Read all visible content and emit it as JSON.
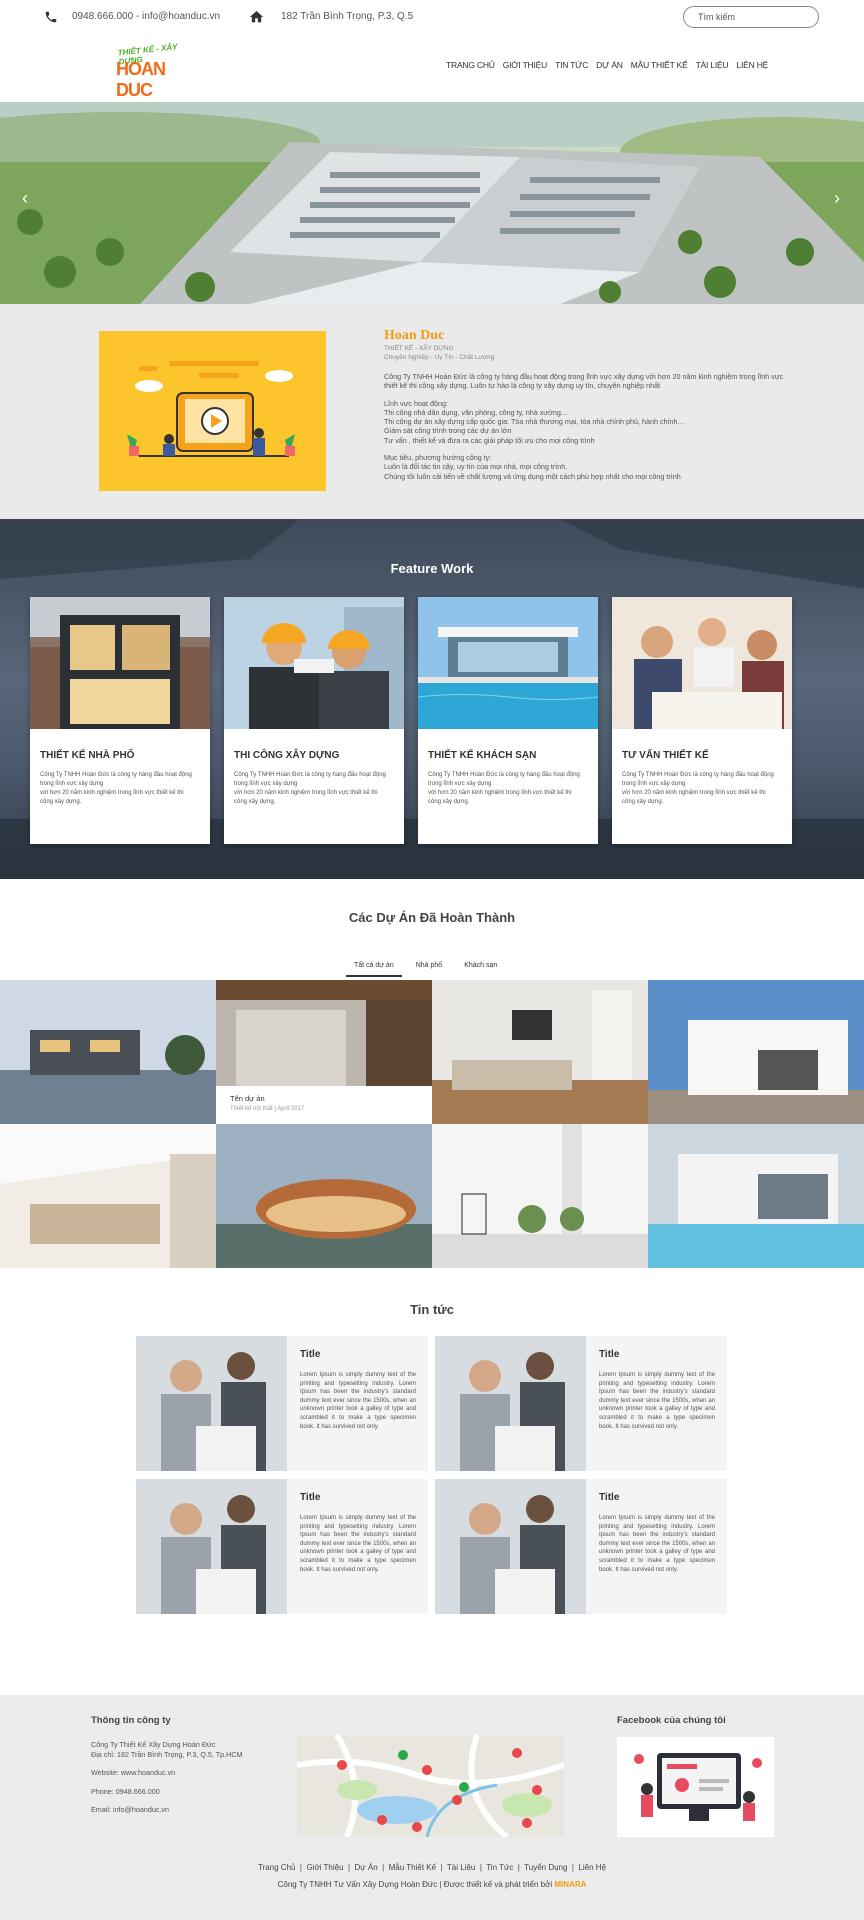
{
  "topbar": {
    "contact": "0948.666.000 - info@hoanduc.vn",
    "address": "182 Trần Bình Trọng, P.3, Q.5",
    "search_placeholder": "Tìm kiếm"
  },
  "logo": {
    "tagline": "THIẾT KẾ - XÂY DỰNG",
    "name": "HOAN DUC"
  },
  "nav": [
    "TRANG CHỦ",
    "GIỚI THIỆU",
    "TIN TỨC",
    "DỰ ÁN",
    "MẪU THIẾT KẾ",
    "TÀI LIỆU",
    "LIÊN HỆ"
  ],
  "hero": {
    "prev": "‹",
    "next": "›"
  },
  "about": {
    "title": "Hoan Duc",
    "sub1": "THIẾT KẾ - XÂY DỰNG",
    "sub2": "Chuyên Nghiệp - Uy Tín - Chất Lượng",
    "intro": "Công Ty TNHH Hoàn Đức là công ty hàng đầu hoạt động trong lĩnh vực xây dựng  với hơn 20 năm kinh nghiệm trong lĩnh vực thiết kế thi công xây dựng. Luôn tự hào là công ty xây dựng uy tín, chuyên nghiệp nhất",
    "fields_heading": "Lĩnh vực hoạt động:",
    "fields": [
      "Thi công nhà dân dụng, văn phòng, công ty, nhà xưởng…",
      "Thi công dự án xây dựng cấp quốc gia: Tòa nhà thương mại, tòa nhà chính phủ, hành chính…",
      "Giám sát công trình trong các dự án lớn",
      "Tư vấn , thiết kế và đưa ra các giải pháp tối ưu cho mọi công trình"
    ],
    "goals_heading": "Mục tiêu, phương hướng công ty:",
    "goals": [
      "Luôn là đối tác tin cậy, uy tín của mọi nhà, mọi công trình.",
      "Chúng tôi luôn cải tiến về chất lượng và ứng dụng một cách phù hợp nhất cho mọi công trình"
    ]
  },
  "feature": {
    "title": "Feature Work",
    "cards": [
      {
        "title": "THIẾT KẾ NHÀ PHỐ",
        "l1": "Công Ty TNHH Hoàn Đức là công ty hàng đầu hoạt động",
        "l2": "trong lĩnh vực xây dựng",
        "l3": "với hơn 20 năm kinh nghiệm trong lĩnh vực thiết kế thi",
        "l4": "công xây dựng."
      },
      {
        "title": "THI CÔNG XÂY DỰNG",
        "l1": "Công Ty TNHH Hoàn Đức là công ty hàng đầu hoạt động",
        "l2": "trong lĩnh vực xây dựng",
        "l3": "với hơn 20 năm kinh nghiệm trong lĩnh vực thiết kế thi",
        "l4": "công xây dựng."
      },
      {
        "title": "THIẾT KẾ KHÁCH SẠN",
        "l1": "Công Ty TNHH Hoàn Đức là công ty hàng đầu hoạt động",
        "l2": "trong lĩnh vực xây dựng",
        "l3": "với hơn 20 năm kinh nghiệm trong lĩnh vực thiết kế thi",
        "l4": "công xây dựng."
      },
      {
        "title": "TƯ VẤN THIẾT KẾ",
        "l1": "Công Ty TNHH Hoàn Đức là công ty hàng đầu hoạt động",
        "l2": "trong lĩnh vực xây dựng",
        "l3": "với hơn 20 năm kinh nghiệm trong lĩnh vực thiết kế thi",
        "l4": "công xây dựng."
      }
    ]
  },
  "projects": {
    "title": "Các Dự Án Đã Hoàn Thành",
    "tabs": [
      "Tất cả dự án",
      "Nhà phố",
      "Khách sạn"
    ],
    "active_tab": "Tất cả dự án",
    "overlay_title": "Tên dự án",
    "overlay_meta": "Thiết kế nội thất | April 2017"
  },
  "news": {
    "title": "Tin tức",
    "item_title": "Title",
    "item_text": "Lorem Ipsum is simply dummy text of the printing and typesetting industry. Lorem Ipsum has been the industry's standard dummy text ever since the 1500s, when an unknown printer took a galley of type and scrambled it to make a type specimen book. It has survived not only."
  },
  "footer": {
    "info_title": "Thông tin công ty",
    "company": "Công Ty Thiết Kế Xây Dựng Hoàn Đức",
    "address": "Địa chỉ: 182 Trần Bình Trọng, P.3, Q.5, Tp.HCM",
    "website": "Website: www.hoanduc.vn",
    "phone": "Phone: 0948.666.000",
    "email": "Email: info@hoanduc.vn",
    "fb_title": "Facebook của chúng tôi",
    "links": [
      "Trang Chủ",
      "Giới Thiệu",
      "Dự Án",
      "Mẫu Thiết Kế",
      "Tài Liệu",
      "Tin Tức",
      "Tuyển Dụng",
      "Liên Hệ"
    ],
    "copyright": "Công Ty TNHH Tư Vấn Xây Dựng Hoàn Đức | Được thiết kế và phát triển bởi",
    "developer": "MINARA"
  },
  "colors": {
    "accent": "#f39c12",
    "about_bg": "#eaeaea",
    "video_bg": "#fbc52b",
    "footer_bg": "#ececec"
  }
}
